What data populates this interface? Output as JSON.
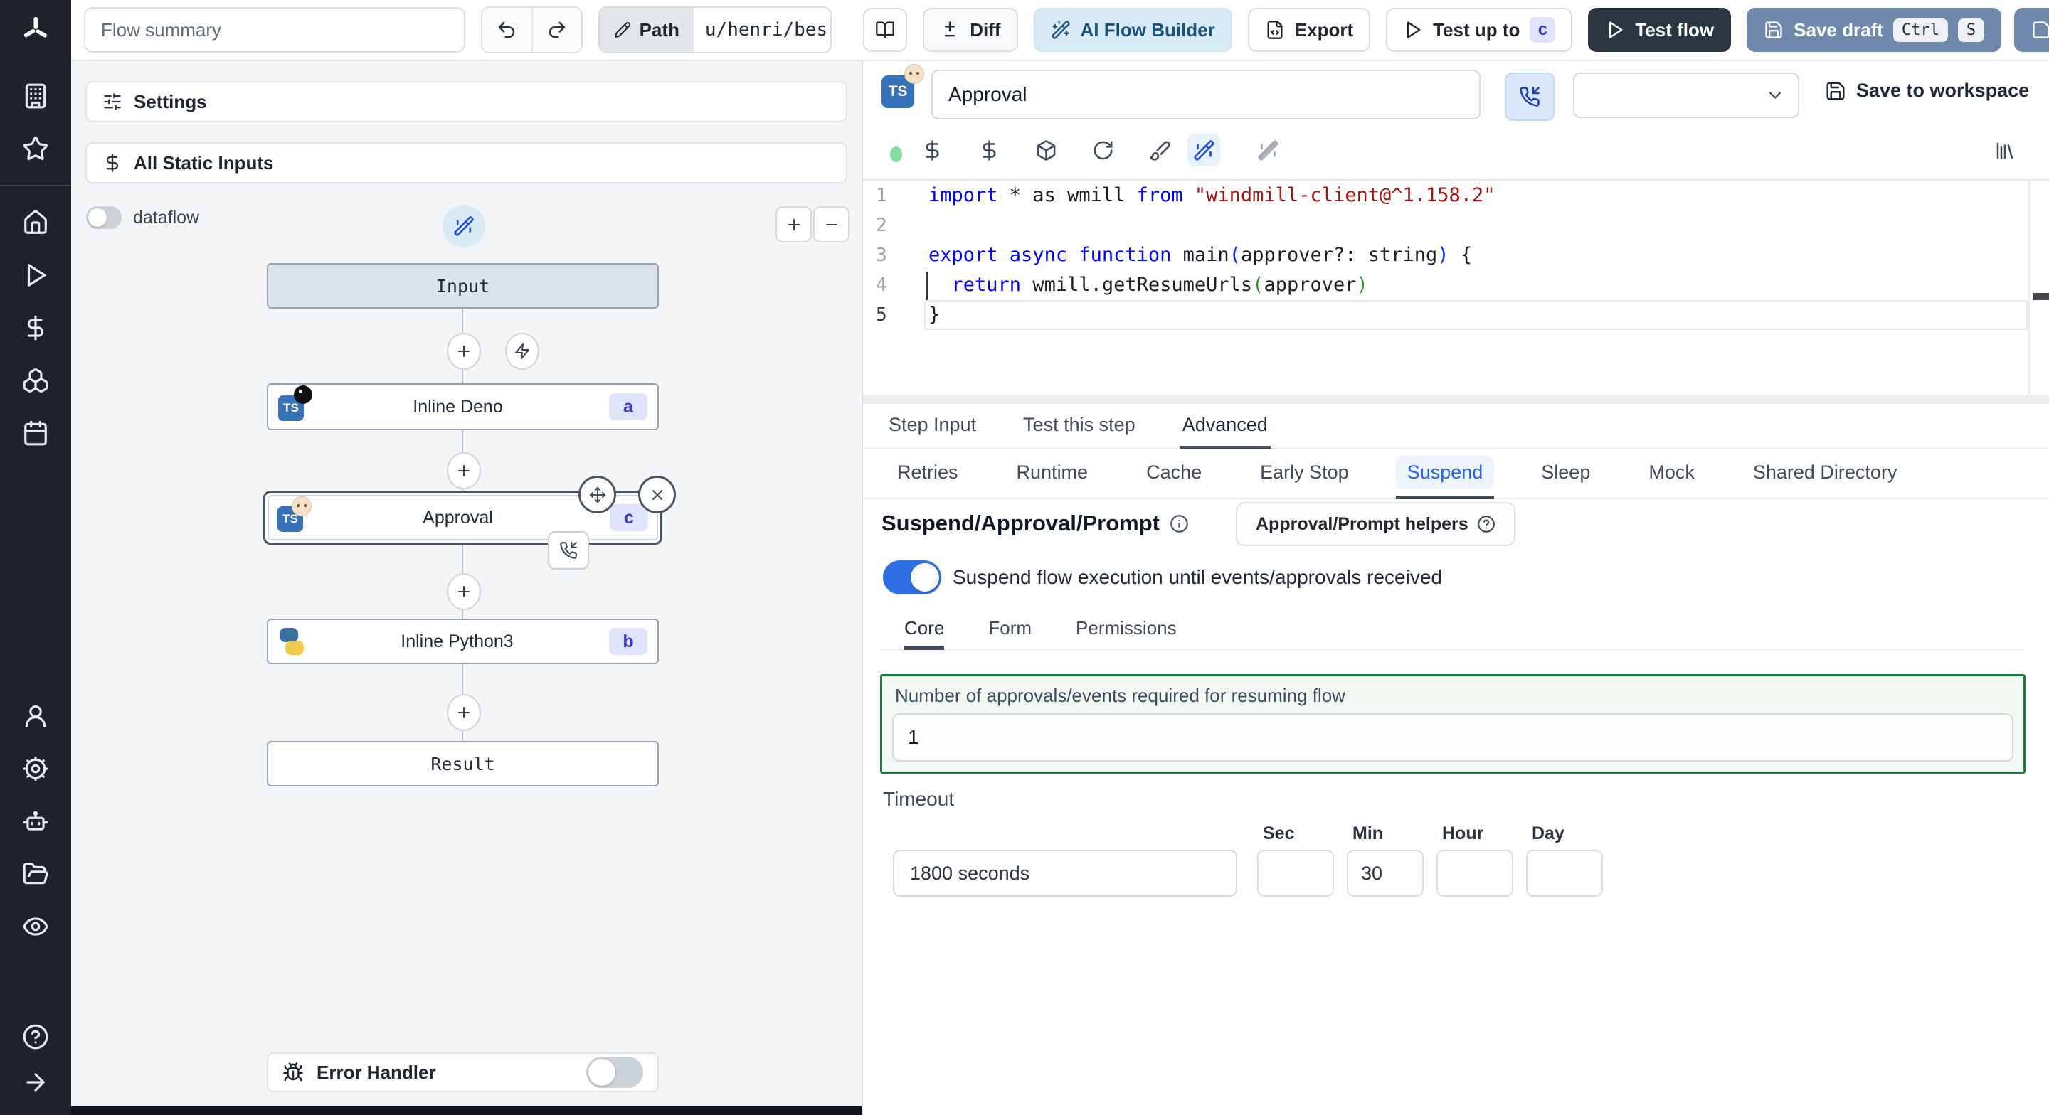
{
  "topbar": {
    "flow_summary_placeholder": "Flow summary",
    "path_label": "Path",
    "path_value": "u/henri/bes",
    "diff_label": "Diff",
    "ai_flow_builder_label": "AI Flow Builder",
    "export_label": "Export",
    "test_up_to_label": "Test up to",
    "test_up_to_badge": "c",
    "test_flow_label": "Test flow",
    "save_draft_label": "Save draft",
    "save_draft_kbd": [
      "Ctrl",
      "S"
    ]
  },
  "flow_panel": {
    "settings_label": "Settings",
    "static_inputs_label": "All Static Inputs",
    "dataflow_label": "dataflow",
    "nodes": {
      "input_label": "Input",
      "deno": {
        "label": "Inline Deno",
        "badge": "a",
        "lang_badge": "TS"
      },
      "approval": {
        "label": "Approval",
        "badge": "c",
        "lang_badge": "TS"
      },
      "python": {
        "label": "Inline Python3",
        "badge": "b"
      },
      "result_label": "Result"
    },
    "error_handler_label": "Error Handler"
  },
  "editor_panel": {
    "step_name": "Approval",
    "lang_badge": "TS",
    "save_to_workspace_label": "Save to workspace",
    "code": {
      "lines": [
        {
          "n": "1",
          "active": false,
          "tokens": [
            {
              "t": "import ",
              "c": "kw"
            },
            {
              "t": "* as wmill ",
              "c": "pl"
            },
            {
              "t": "from ",
              "c": "kw"
            },
            {
              "t": "\"windmill-client@^1.158.2\"",
              "c": "str"
            }
          ]
        },
        {
          "n": "2",
          "active": false,
          "tokens": []
        },
        {
          "n": "3",
          "active": false,
          "tokens": [
            {
              "t": "export ",
              "c": "kw"
            },
            {
              "t": "async ",
              "c": "kw"
            },
            {
              "t": "function ",
              "c": "kw"
            },
            {
              "t": "main",
              "c": "pl"
            },
            {
              "t": "(",
              "c": "b1"
            },
            {
              "t": "approver?: string",
              "c": "pl"
            },
            {
              "t": ")",
              "c": "b1"
            },
            {
              "t": " {",
              "c": "pl"
            }
          ]
        },
        {
          "n": "4",
          "active": false,
          "tokens": [
            {
              "t": "  ",
              "c": "pl"
            },
            {
              "t": "return ",
              "c": "kw"
            },
            {
              "t": "wmill.getResumeUrls",
              "c": "pl"
            },
            {
              "t": "(",
              "c": "b2"
            },
            {
              "t": "approver",
              "c": "pl"
            },
            {
              "t": ")",
              "c": "b2"
            }
          ]
        },
        {
          "n": "5",
          "active": true,
          "tokens": [
            {
              "t": "}",
              "c": "pl"
            }
          ]
        }
      ]
    },
    "tabs": [
      {
        "label": "Step Input",
        "active": false
      },
      {
        "label": "Test this step",
        "active": false
      },
      {
        "label": "Advanced",
        "active": true
      }
    ],
    "advanced_tabs": [
      {
        "label": "Retries",
        "active": false
      },
      {
        "label": "Runtime",
        "active": false
      },
      {
        "label": "Cache",
        "active": false
      },
      {
        "label": "Early Stop",
        "active": false
      },
      {
        "label": "Suspend",
        "active": true
      },
      {
        "label": "Sleep",
        "active": false
      },
      {
        "label": "Mock",
        "active": false
      },
      {
        "label": "Shared Directory",
        "active": false
      }
    ],
    "suspend": {
      "title": "Suspend/Approval/Prompt",
      "helpers_button_label": "Approval/Prompt helpers",
      "toggle_label": "Suspend flow execution until events/approvals received",
      "toggle_on": true,
      "tabs": [
        {
          "label": "Core",
          "active": true
        },
        {
          "label": "Form",
          "active": false
        },
        {
          "label": "Permissions",
          "active": false
        }
      ],
      "approvals_label": "Number of approvals/events required for resuming flow",
      "approvals_value": "1",
      "timeout_label": "Timeout",
      "timeout_value": "1800 seconds",
      "timeout_units": [
        {
          "label": "Sec",
          "value": ""
        },
        {
          "label": "Min",
          "value": "30"
        },
        {
          "label": "Hour",
          "value": ""
        },
        {
          "label": "Day",
          "value": ""
        }
      ]
    }
  },
  "colors": {
    "sidebar_bg": "#1e232b",
    "accent_toggle_blue": "#2f6fe4",
    "suspend_active_text": "#2563eb",
    "node_badge_bg": "#dfe3fb",
    "node_badge_text": "#4338ca",
    "ts_badge_bg": "#3873b9",
    "save_draft_bg": "#6f88ac",
    "test_flow_bg": "#2b3642",
    "ai_builder_bg": "#d9eaf7",
    "green_box_border": "#1d7c40",
    "code_keyword": "#0000ff",
    "code_string": "#a31515"
  }
}
